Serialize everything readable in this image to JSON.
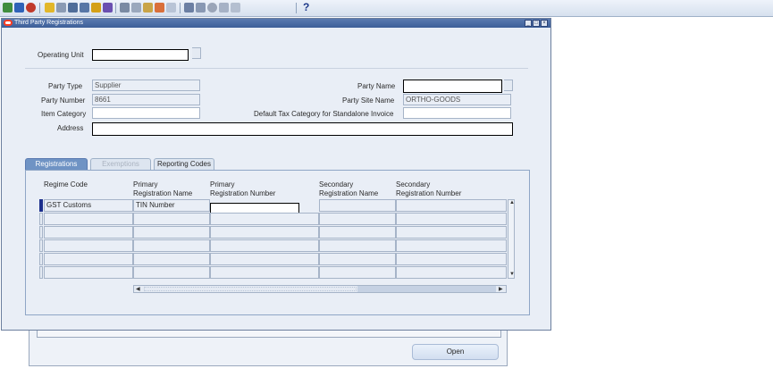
{
  "toolbar": {
    "icons": [
      "new-record-icon",
      "find-icon",
      "navigator-icon",
      "save-icon",
      "switch-responsibility-icon",
      "print-icon",
      "close-form-icon",
      "cut-icon",
      "copy-icon",
      "paste-icon",
      "clear-record-icon",
      "delete-record-icon",
      "edit-field-icon",
      "zoom-icon",
      "translations-icon",
      "attachments-icon",
      "folder-tools-icon",
      "help-icon"
    ],
    "help_label": "?"
  },
  "window": {
    "title": "Third Party Registrations"
  },
  "header": {
    "operating_unit_label": "Operating Unit",
    "operating_unit_value": "",
    "party_type_label": "Party Type",
    "party_type_value": "Supplier",
    "party_number_label": "Party Number",
    "party_number_value": "8661",
    "item_category_label": "Item Category",
    "item_category_value": "",
    "address_label": "Address",
    "address_value": "",
    "party_name_label": "Party Name",
    "party_name_value": "",
    "party_site_name_label": "Party Site Name",
    "party_site_name_value": "ORTHO-GOODS",
    "default_tax_label": "Default Tax Category for Standalone Invoice",
    "default_tax_value": ""
  },
  "tabs": [
    {
      "label": "Registrations",
      "state": "active"
    },
    {
      "label": "Exemptions",
      "state": "disabled"
    },
    {
      "label": "Reporting Codes",
      "state": "normal"
    }
  ],
  "grid": {
    "columns": [
      {
        "line1": "",
        "line2": "Regime Code"
      },
      {
        "line1": "Primary",
        "line2": "Registration Name"
      },
      {
        "line1": "Primary",
        "line2": "Registration Number"
      },
      {
        "line1": "Secondary",
        "line2": "Registration Name"
      },
      {
        "line1": "Secondary",
        "line2": "Registration Number"
      }
    ],
    "rows": [
      [
        "GST Customs",
        "TIN Number",
        "",
        "",
        ""
      ],
      [
        "",
        "",
        "",
        "",
        ""
      ],
      [
        "",
        "",
        "",
        "",
        ""
      ],
      [
        "",
        "",
        "",
        "",
        ""
      ],
      [
        "",
        "",
        "",
        "",
        ""
      ],
      [
        "",
        "",
        "",
        "",
        ""
      ]
    ]
  },
  "back_window": {
    "open_button": "Open"
  },
  "colors": {
    "titlebar": "#3d5f99",
    "active_tab": "#6f93c4",
    "current_row_indicator": "#1c2f8c"
  }
}
